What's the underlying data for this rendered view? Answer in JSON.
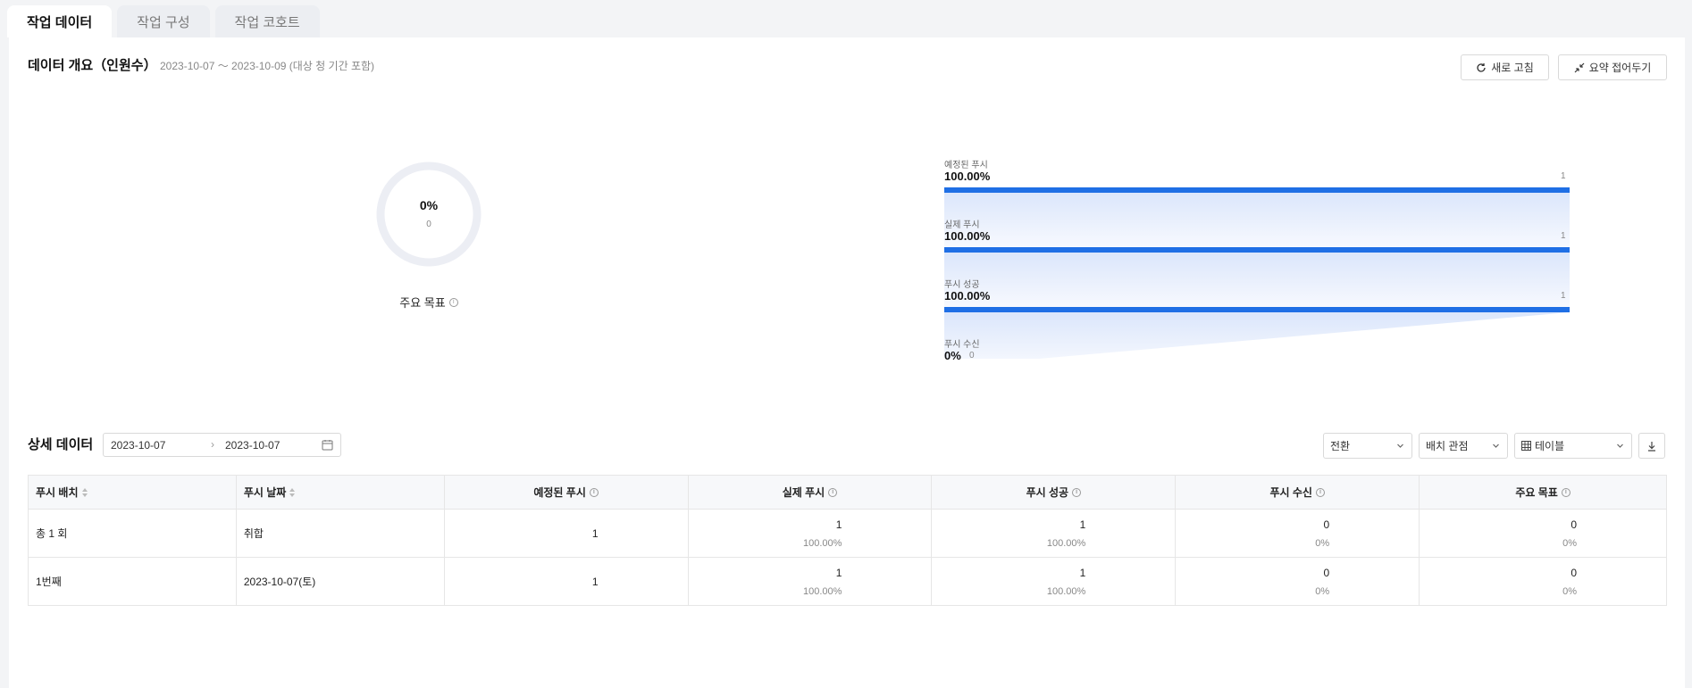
{
  "tabs": [
    {
      "label": "작업 데이터",
      "active": true
    },
    {
      "label": "작업 구성",
      "active": false
    },
    {
      "label": "작업 코호트",
      "active": false
    }
  ],
  "overview": {
    "title": "데이터 개요（인원수）",
    "range": "2023-10-07 ～ 2023-10-09 (대상 청 기간 포함)",
    "refresh_label": "새로 고침",
    "collapse_label": "요약 접어두기"
  },
  "goal": {
    "percent": "0%",
    "percent_value": 0,
    "count": "0",
    "label": "주요 목표"
  },
  "funnel": [
    {
      "label": "예정된 푸시",
      "percent": "100.00%",
      "value": 1,
      "count": "1"
    },
    {
      "label": "실제 푸시",
      "percent": "100.00%",
      "value": 1,
      "count": "1"
    },
    {
      "label": "푸시 성공",
      "percent": "100.00%",
      "value": 1,
      "count": "1"
    },
    {
      "label": "푸시 수신",
      "percent": "0%",
      "value": 0,
      "count": "0"
    }
  ],
  "detail": {
    "title": "상세 데이터",
    "date_start": "2023-10-07",
    "date_end": "2023-10-07",
    "select_conversion": "전환",
    "select_batch": "배치 관점",
    "select_view": "테이블"
  },
  "colors": {
    "accent": "#1f6fe5",
    "donut_track": "#eceef4"
  },
  "table": {
    "headers": [
      "푸시 배치",
      "푸시 날짜",
      "예정된 푸시",
      "실제 푸시",
      "푸시 성공",
      "푸시 수신",
      "주요 목표"
    ],
    "rows": [
      {
        "batch": "총 1 회",
        "date": "취합",
        "scheduled": "1",
        "actual": "1",
        "actual_pct": "100.00%",
        "success": "1",
        "success_pct": "100.00%",
        "received": "0",
        "received_pct": "0%",
        "goal": "0",
        "goal_pct": "0%"
      },
      {
        "batch": "1번째",
        "date": "2023-10-07(토)",
        "scheduled": "1",
        "actual": "1",
        "actual_pct": "100.00%",
        "success": "1",
        "success_pct": "100.00%",
        "received": "0",
        "received_pct": "0%",
        "goal": "0",
        "goal_pct": "0%"
      }
    ]
  }
}
